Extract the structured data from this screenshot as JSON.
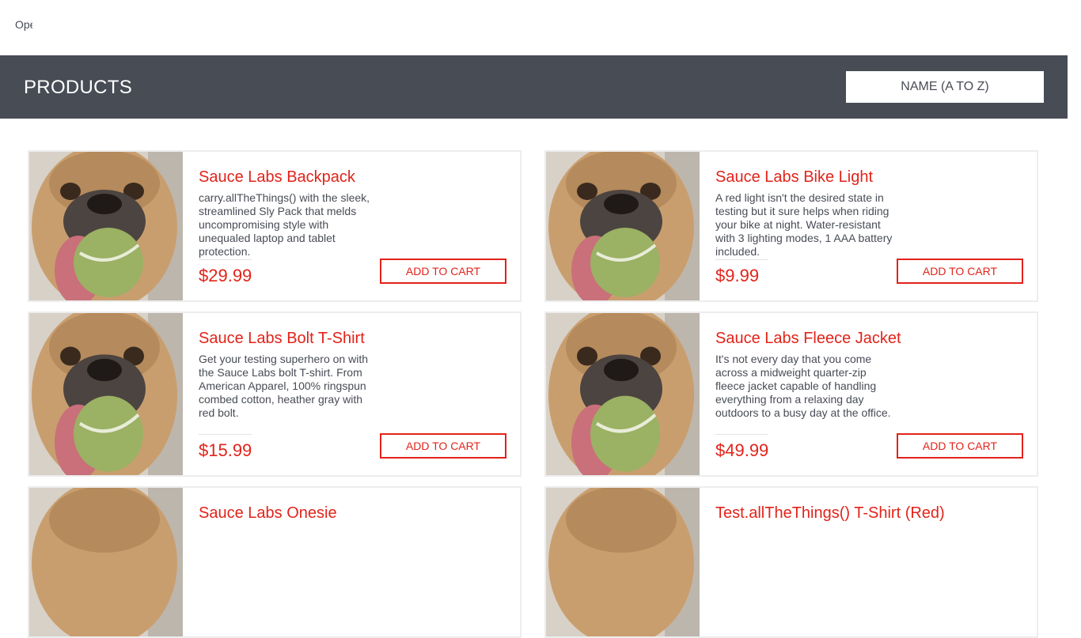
{
  "menu": {
    "label": "Open Menu"
  },
  "header": {
    "title": "PRODUCTS",
    "sort_value": "NAME (A TO Z)"
  },
  "colors": {
    "accent": "#e2231a",
    "header_bg": "#474c55",
    "text": "#484c55"
  },
  "products": [
    {
      "name": "Sauce Labs Backpack",
      "description": "carry.allTheThings() with the sleek, streamlined Sly Pack that melds uncompromising style with unequaled laptop and tablet protection.",
      "price": "$29.99",
      "button": "ADD TO CART"
    },
    {
      "name": "Sauce Labs Bike Light",
      "description": "A red light isn't the desired state in testing but it sure helps when riding your bike at night. Water-resistant with 3 lighting modes, 1 AAA battery included.",
      "price": "$9.99",
      "button": "ADD TO CART"
    },
    {
      "name": "Sauce Labs Bolt T-Shirt",
      "description": "Get your testing superhero on with the Sauce Labs bolt T-shirt. From American Apparel, 100% ringspun combed cotton, heather gray with red bolt.",
      "price": "$15.99",
      "button": "ADD TO CART"
    },
    {
      "name": "Sauce Labs Fleece Jacket",
      "description": "It's not every day that you come across a midweight quarter-zip fleece jacket capable of handling everything from a relaxing day outdoors to a busy day at the office.",
      "price": "$49.99",
      "button": "ADD TO CART"
    },
    {
      "name": "Sauce Labs Onesie",
      "description": "",
      "price": "",
      "button": ""
    },
    {
      "name": "Test.allTheThings() T-Shirt (Red)",
      "description": "",
      "price": "",
      "button": ""
    }
  ]
}
